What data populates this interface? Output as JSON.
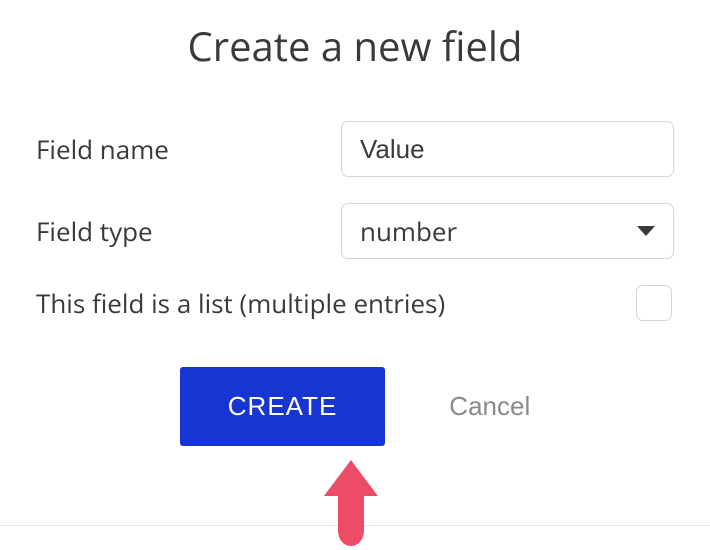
{
  "dialog": {
    "title": "Create a new field",
    "fieldName": {
      "label": "Field name",
      "value": "Value"
    },
    "fieldType": {
      "label": "Field type",
      "selected": "number"
    },
    "listCheckbox": {
      "label": "This field is a list (multiple entries)",
      "checked": false
    },
    "buttons": {
      "create": "CREATE",
      "cancel": "Cancel"
    }
  },
  "annotation": {
    "arrowColor": "#ed4c67"
  }
}
